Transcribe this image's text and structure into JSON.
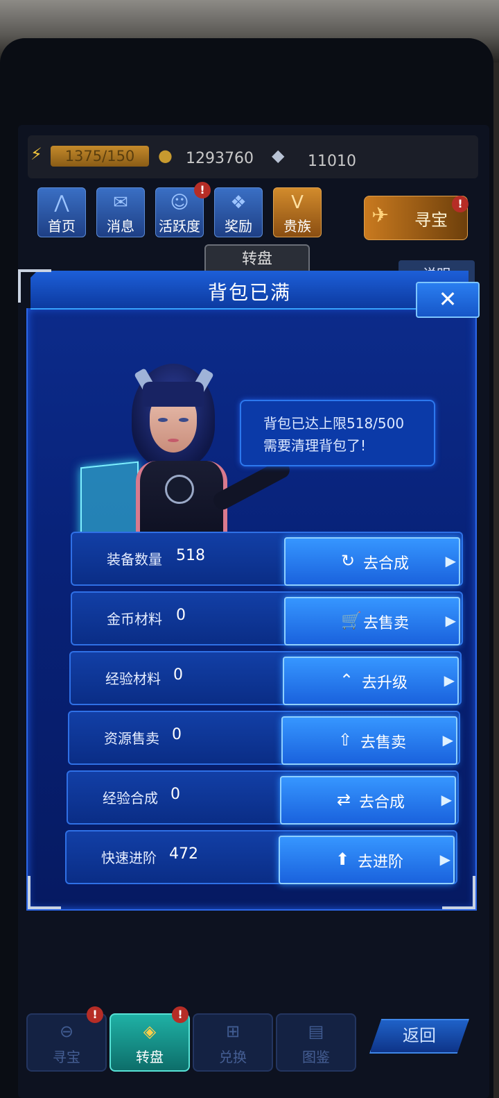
{
  "resources": {
    "energy": "1375/150",
    "gold": "1293760",
    "diamond": "11010"
  },
  "nav": [
    {
      "label": "首页",
      "icon": "home-emblem-icon",
      "badge": ""
    },
    {
      "label": "消息",
      "icon": "message-icon",
      "badge": ""
    },
    {
      "label": "活跃度",
      "icon": "activity-icon",
      "badge": "!"
    },
    {
      "label": "奖励",
      "icon": "gift-icon",
      "badge": ""
    },
    {
      "label": "贵族",
      "icon": "noble-v-icon",
      "badge": ""
    }
  ],
  "treasure_button": {
    "label": "寻宝",
    "icon": "fighter-jet-icon",
    "badge": "!"
  },
  "sub_tabs": {
    "active": "转盘",
    "description": "说明"
  },
  "modal": {
    "title": "背包已满",
    "close_icon": "close-icon",
    "bubble": {
      "line1": "背包已达上限518/500",
      "line2": "需要清理背包了!"
    },
    "rows": [
      {
        "label": "装备数量",
        "value": "518",
        "button": "去合成",
        "icon": "refresh-icon"
      },
      {
        "label": "金币材料",
        "value": "0",
        "button": "去售卖",
        "icon": "cart-icon"
      },
      {
        "label": "经验材料",
        "value": "0",
        "button": "去升级",
        "icon": "upgrade-chevron-icon"
      },
      {
        "label": "资源售卖",
        "value": "0",
        "button": "去售卖",
        "icon": "upload-icon"
      },
      {
        "label": "经验合成",
        "value": "0",
        "button": "去合成",
        "icon": "merge-icon"
      },
      {
        "label": "快速进阶",
        "value": "472",
        "button": "去进阶",
        "icon": "up-arrow-icon"
      }
    ]
  },
  "bottom_nav": [
    {
      "label": "寻宝",
      "badge": "!",
      "active": false
    },
    {
      "label": "转盘",
      "badge": "!",
      "active": true
    },
    {
      "label": "兑换",
      "badge": "",
      "active": false
    },
    {
      "label": "图鉴",
      "badge": "",
      "active": false
    }
  ],
  "back_button": "返回"
}
